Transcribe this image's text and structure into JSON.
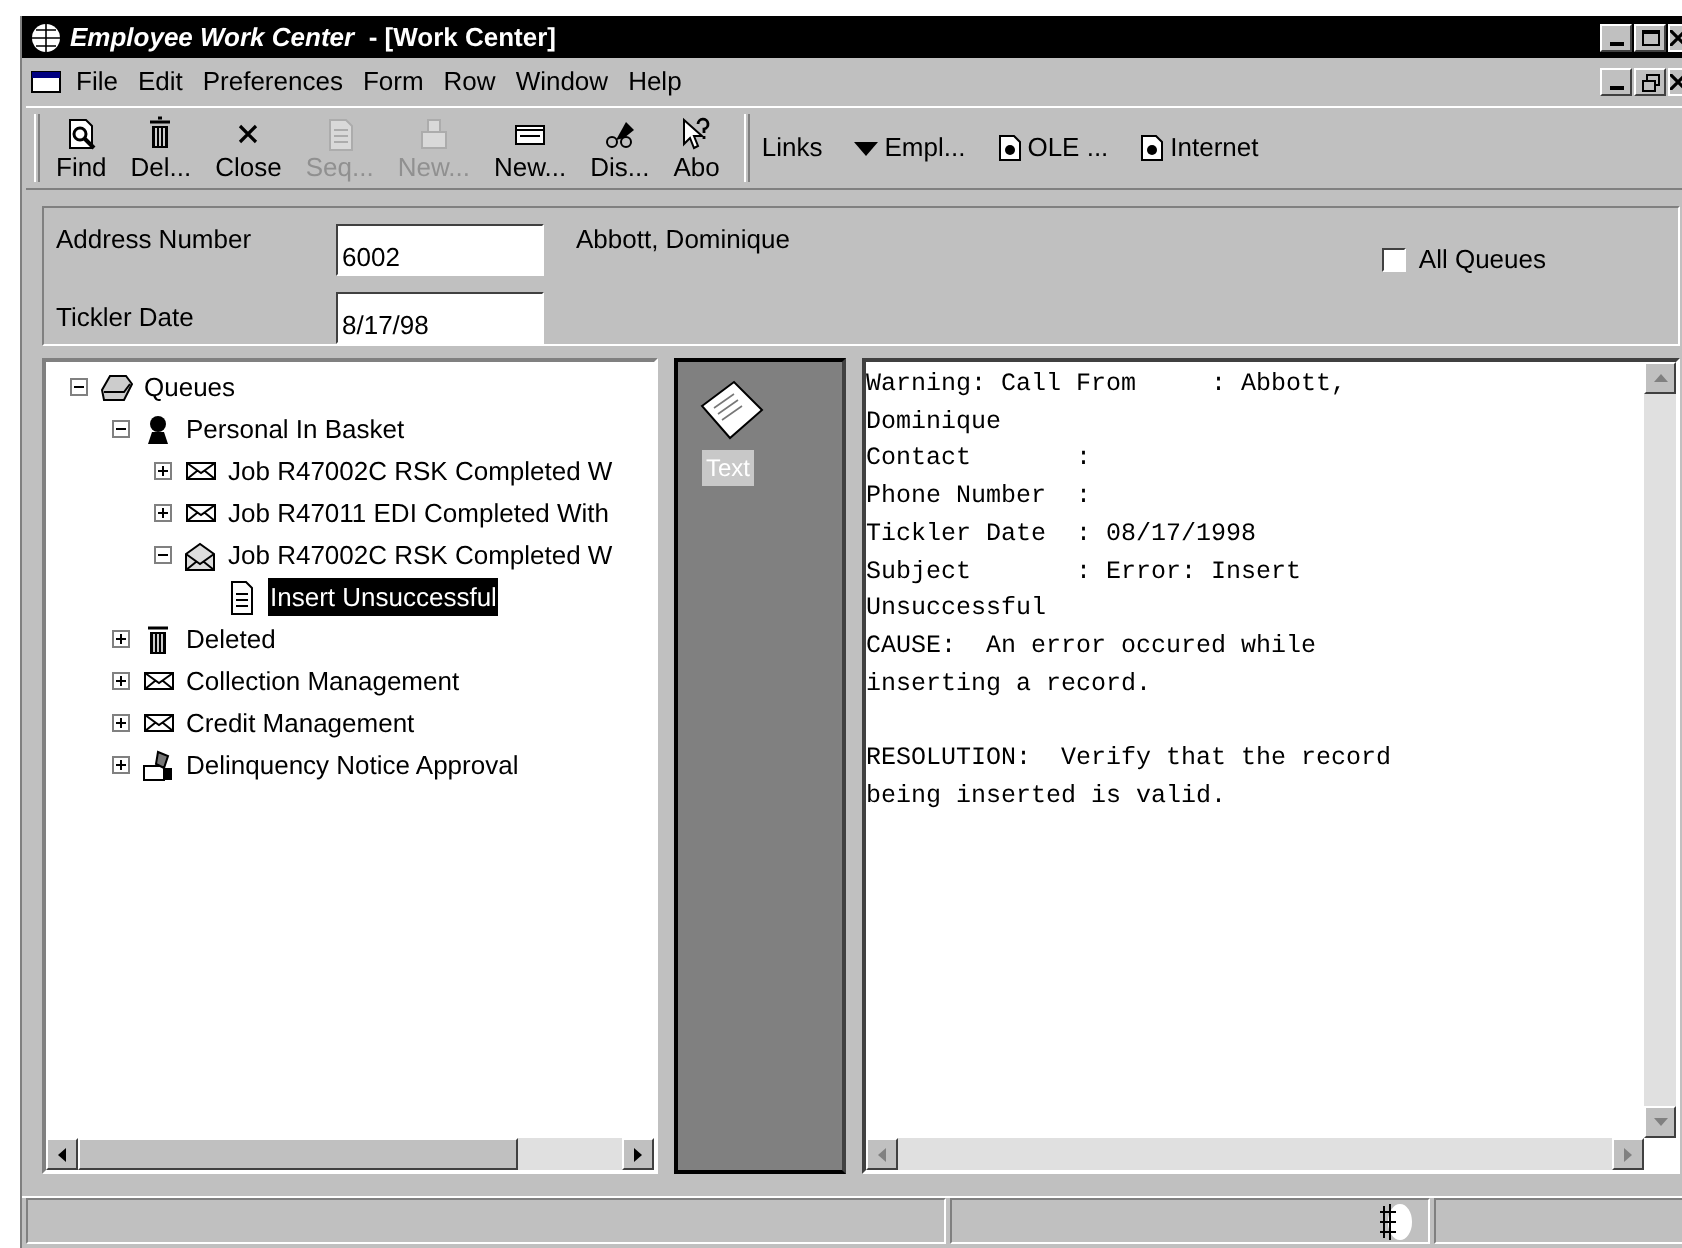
{
  "window": {
    "title": "*Employee Work Center*  - [Work Center]"
  },
  "menu": [
    "File",
    "Edit",
    "Preferences",
    "Form",
    "Row",
    "Window",
    "Help"
  ],
  "toolbar": [
    {
      "label": "Find",
      "kind": "find",
      "disabled": false
    },
    {
      "label": "Del...",
      "kind": "trash",
      "disabled": false
    },
    {
      "label": "Close",
      "kind": "close",
      "disabled": false
    },
    {
      "label": "Seq...",
      "kind": "doc",
      "disabled": true
    },
    {
      "label": "New...",
      "kind": "newdoc",
      "disabled": true
    },
    {
      "label": "New...",
      "kind": "mail",
      "disabled": false
    },
    {
      "label": "Dis...",
      "kind": "glasses",
      "disabled": false
    },
    {
      "label": "Abo",
      "kind": "help",
      "disabled": false
    }
  ],
  "links": [
    {
      "label": "Links",
      "kind": "text"
    },
    {
      "label": "Empl...",
      "kind": "dropdown"
    },
    {
      "label": "OLE ...",
      "kind": "doc"
    },
    {
      "label": "Internet",
      "kind": "doc"
    }
  ],
  "form": {
    "address_label": "Address Number",
    "address_value": "6002",
    "name": "Abbott, Dominique",
    "all_queues": {
      "label": "All Queues",
      "checked": false
    },
    "tickler_label": "Tickler Date",
    "tickler_value": "8/17/98"
  },
  "tree": [
    {
      "label": "Queues",
      "kind": "queue",
      "expanded": true,
      "selected": false,
      "children": [
        {
          "label": "Personal In Basket",
          "kind": "person",
          "expanded": true,
          "selected": false,
          "children": [
            {
              "label": "Job R47002C RSK Completed W",
              "kind": "mail",
              "expanded": false,
              "selected": false
            },
            {
              "label": "Job R47011 EDI Completed With",
              "kind": "mail",
              "expanded": false,
              "selected": false
            },
            {
              "label": "Job R47002C RSK Completed W",
              "kind": "openmail",
              "expanded": true,
              "selected": false,
              "children": [
                {
                  "label": "Insert Unsuccessful",
                  "kind": "doc",
                  "selected": true
                }
              ]
            }
          ]
        },
        {
          "label": "Deleted",
          "kind": "trash",
          "expanded": false,
          "selected": false
        },
        {
          "label": "Collection Management",
          "kind": "mail",
          "expanded": false,
          "selected": false
        },
        {
          "label": "Credit Management",
          "kind": "mail",
          "expanded": false,
          "selected": false
        },
        {
          "label": "Delinquency Notice Approval",
          "kind": "approval",
          "expanded": false,
          "selected": false
        }
      ]
    }
  ],
  "media": {
    "item_label": "Text"
  },
  "message": [
    [
      "Warning: Call From     : Abbott,",
      "Dominique",
      "Contact       :",
      "Phone Number  :",
      "Tickler Date  : 08/17/1998",
      "Subject       : Error: Insert",
      "Unsuccessful",
      "CAUSE:  An error occured while",
      "inserting a record."
    ],
    [
      "RESOLUTION:  Verify that the record",
      "being inserted is valid."
    ]
  ]
}
